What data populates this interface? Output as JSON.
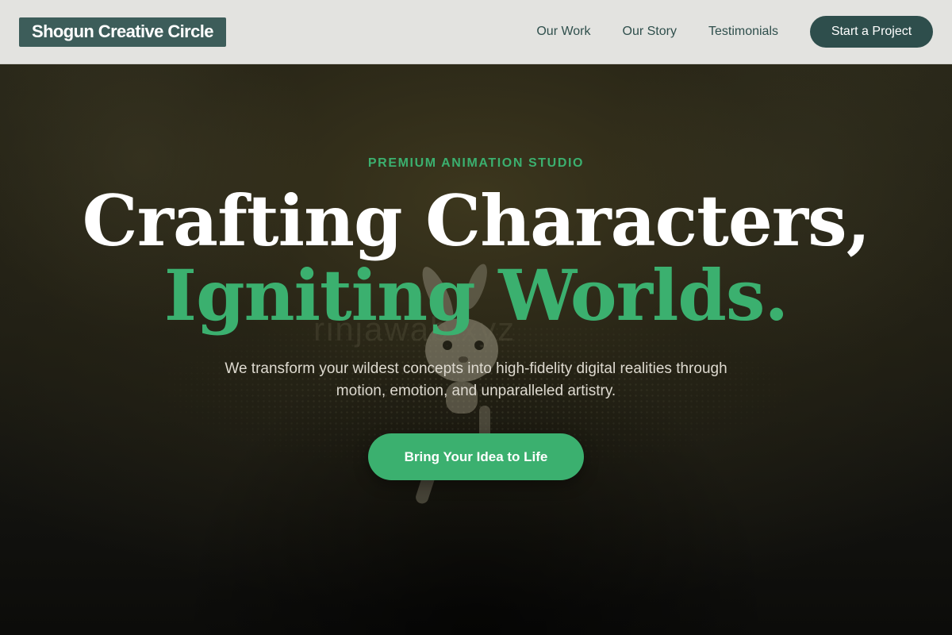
{
  "nav": {
    "logo": "Shogun Creative Circle",
    "links": [
      "Our Work",
      "Our Story",
      "Testimonials"
    ],
    "cta_label": "Start a Project"
  },
  "hero": {
    "eyebrow": "PREMIUM ANIMATION STUDIO",
    "headline_line1": "Crafting Characters,",
    "headline_line2": "Igniting Worlds.",
    "watermark": "rinjawab.xyz",
    "subtext": "We transform your wildest concepts into high-fidelity digital realities through motion, emotion, and unparalleled artistry.",
    "cta_label": "Bring Your Idea to Life"
  },
  "colors": {
    "brand_dark": "#2e4e4c",
    "accent_green": "#3bb06f",
    "nav_bg": "#e3e3e0"
  }
}
